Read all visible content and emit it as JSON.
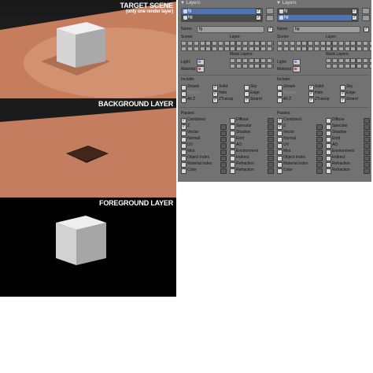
{
  "panels": [
    {
      "title": "TARGET SCENE",
      "subtitle": "(only one render layer)"
    },
    {
      "title": "BACKGROUND LAYER",
      "subtitle": ""
    },
    {
      "title": "FOREGROUND LAYER",
      "subtitle": ""
    }
  ],
  "properties": [
    {
      "header": "Layers",
      "layers": [
        {
          "name": "fg",
          "selected": true
        },
        {
          "name": "bg",
          "selected": false
        }
      ],
      "name_label": "Name:",
      "name_value": "fg",
      "scene_label": "Scene:",
      "layer_label": "Layer:",
      "mask_layers_label": "Mask Layers:",
      "light_label": "Light:",
      "material_label": "Material:",
      "include_label": "Include:",
      "include": [
        {
          "label": "Zmask",
          "checked": false
        },
        {
          "label": "Solid",
          "checked": true
        },
        {
          "label": "Sky",
          "checked": false
        },
        {
          "label": "Negate",
          "checked": false,
          "dim": true
        },
        {
          "label": "Halo",
          "checked": true
        },
        {
          "label": "Edge",
          "checked": false
        },
        {
          "label": "All Z",
          "checked": false
        },
        {
          "label": "ZTransp",
          "checked": true
        },
        {
          "label": "Strand",
          "checked": true
        }
      ],
      "passes_label": "Passes:",
      "passes_left": [
        {
          "label": "Combined",
          "checked": true
        },
        {
          "label": "Z",
          "checked": true
        },
        {
          "label": "Vector",
          "checked": false
        },
        {
          "label": "Normal",
          "checked": false
        },
        {
          "label": "UV",
          "checked": false
        },
        {
          "label": "Mist",
          "checked": false
        },
        {
          "label": "Object Index",
          "checked": false
        },
        {
          "label": "Material Index",
          "checked": false
        },
        {
          "label": "Color",
          "checked": false
        }
      ],
      "passes_right": [
        {
          "label": "Diffuse",
          "checked": false
        },
        {
          "label": "Specular",
          "checked": false
        },
        {
          "label": "Shadow",
          "checked": false
        },
        {
          "label": "Emit",
          "checked": false
        },
        {
          "label": "AO",
          "checked": false
        },
        {
          "label": "Environment",
          "checked": false
        },
        {
          "label": "Indirect",
          "checked": false
        },
        {
          "label": "Refraction",
          "checked": false
        },
        {
          "label": "Refraction",
          "checked": false
        }
      ]
    },
    {
      "header": "Layers",
      "layers": [
        {
          "name": "fg",
          "selected": false
        },
        {
          "name": "bg",
          "selected": true
        }
      ],
      "name_label": "Name:",
      "name_value": "bg",
      "scene_label": "Scene:",
      "layer_label": "Layer:",
      "mask_layers_label": "Mask Layers:",
      "light_label": "Light:",
      "material_label": "Material:",
      "include_label": "Include:",
      "include": [
        {
          "label": "Zmask",
          "checked": false
        },
        {
          "label": "Solid",
          "checked": true
        },
        {
          "label": "Sky",
          "checked": false
        },
        {
          "label": "Negate",
          "checked": false,
          "dim": true
        },
        {
          "label": "Halo",
          "checked": true
        },
        {
          "label": "Edge",
          "checked": true
        },
        {
          "label": "All Z",
          "checked": false
        },
        {
          "label": "ZTransp",
          "checked": true
        },
        {
          "label": "Strand",
          "checked": true
        }
      ],
      "passes_label": "Passes:",
      "passes_left": [
        {
          "label": "Combined",
          "checked": true
        },
        {
          "label": "Z",
          "checked": true
        },
        {
          "label": "Vector",
          "checked": false
        },
        {
          "label": "Normal",
          "checked": false
        },
        {
          "label": "UV",
          "checked": false
        },
        {
          "label": "Mist",
          "checked": false
        },
        {
          "label": "Object Index",
          "checked": false
        },
        {
          "label": "Material Index",
          "checked": false
        },
        {
          "label": "Color",
          "checked": false
        }
      ],
      "passes_right": [
        {
          "label": "Diffuse",
          "checked": false
        },
        {
          "label": "Specular",
          "checked": false
        },
        {
          "label": "Shadow",
          "checked": false
        },
        {
          "label": "Emit",
          "checked": false
        },
        {
          "label": "AO",
          "checked": false
        },
        {
          "label": "Environment",
          "checked": false
        },
        {
          "label": "Indirect",
          "checked": false
        },
        {
          "label": "Refraction",
          "checked": false
        },
        {
          "label": "Refraction",
          "checked": false
        }
      ]
    }
  ]
}
